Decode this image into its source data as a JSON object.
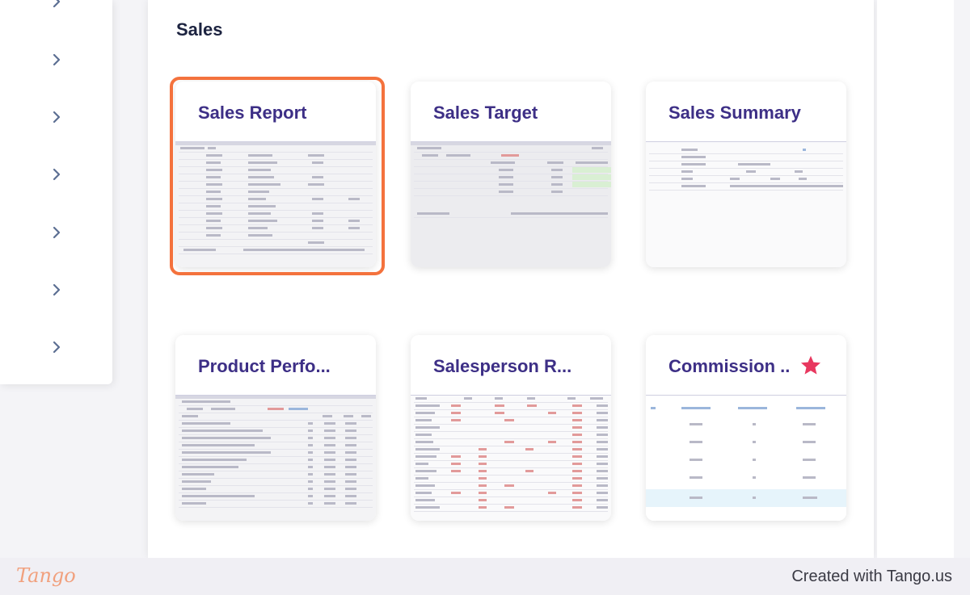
{
  "section": {
    "title": "Sales"
  },
  "cards": [
    {
      "title": "Sales Report",
      "selected": true
    },
    {
      "title": "Sales Target"
    },
    {
      "title": "Sales Summary"
    },
    {
      "title": "Product Perfo..."
    },
    {
      "title": "Salesperson R..."
    },
    {
      "title": "Commission ...",
      "favorite": true
    }
  ],
  "sidebar": {
    "chevron_icon": "chevron-right-icon"
  },
  "footer": {
    "logo": "Tango",
    "credit": "Created with Tango.us"
  },
  "colors": {
    "card_title": "#3d2f86",
    "selection_border": "#f4723d",
    "star": "#e8385f",
    "chevron": "#5c6f93"
  }
}
